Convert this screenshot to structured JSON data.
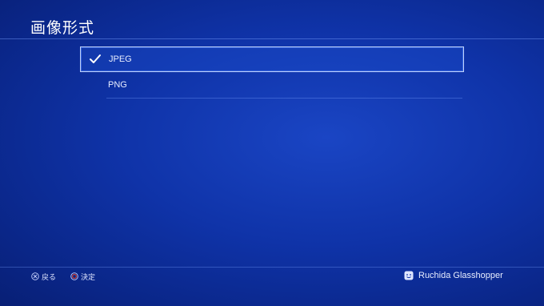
{
  "header": {
    "title": "画像形式"
  },
  "options": [
    {
      "label": "JPEG",
      "selected": true
    },
    {
      "label": "PNG",
      "selected": false
    }
  ],
  "footer": {
    "back_label": "戻る",
    "back_icon": "cross-button-icon",
    "confirm_label": "決定",
    "confirm_icon": "circle-button-icon"
  },
  "user": {
    "name": "Ruchida Glasshopper",
    "avatar_icon": "smiley-avatar-icon"
  },
  "colors": {
    "background": "#0f33a8",
    "circle_button": "#e0422e",
    "text": "#ffffff"
  }
}
